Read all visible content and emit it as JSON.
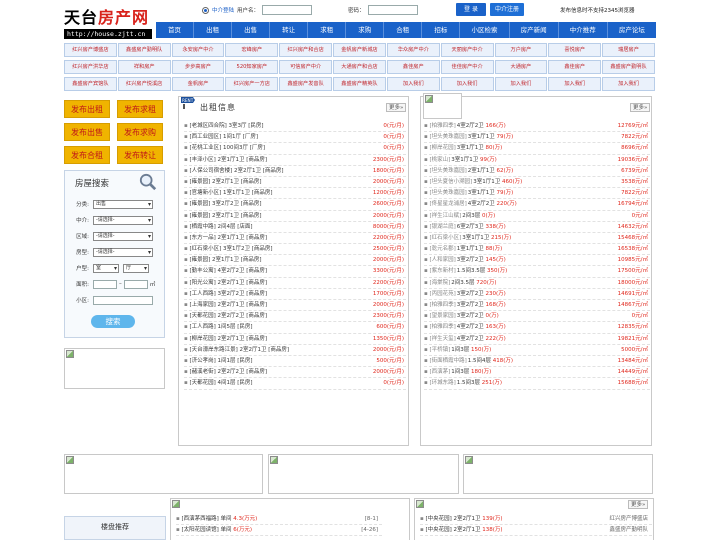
{
  "header": {
    "logo_text_a": "天台",
    "logo_text_b": "房产网",
    "logo_url": "http://house.zjtt.cn",
    "radio_label": "中介登陆",
    "username_label": "用户名：",
    "password_label": "密码：",
    "login_btn": "登 录",
    "register_btn": "中介注册",
    "notice": "发布信息时不支持2345浏览器"
  },
  "nav": [
    "首页",
    "出租",
    "出售",
    "转让",
    "求租",
    "求购",
    "合租",
    "招标",
    "小区检索",
    "房产新闻",
    "中介推荐",
    "房产论坛"
  ],
  "nav_row1": [
    "红兴房产博盛店",
    "鑫盛房产勤明队",
    "永安房产中介",
    "宏峰房产",
    "红兴房产和合店",
    "金帆房产新城店",
    "华众房产中介",
    "天丽房产中介",
    "万户房产",
    "喜悦房产",
    "瑞居房产"
  ],
  "nav_row2": [
    "红兴房产洪华店",
    "祥和房产",
    "步步高房产",
    "520知家房产",
    "可信房产中介",
    "大通房产和合店",
    "鑫佳房产",
    "佳佳房产中介",
    "大通房产",
    "鑫佳房产",
    "鑫盛房产勤明队"
  ],
  "nav_row3": [
    "鑫盛房产宾馆队",
    "红兴房产悦溪店",
    "金帆房产",
    "红兴房产一方店",
    "鑫盛房产发音队",
    "鑫盛房产精英队",
    "加入我们",
    "加入我们",
    "加入我们",
    "加入我们",
    "加入我们"
  ],
  "left": {
    "buttons": [
      "发布出租",
      "发布求租",
      "发布出售",
      "发布求购",
      "发布合租",
      "发布转让"
    ],
    "search_title": "房屋搜索",
    "f_type": "分类:",
    "f_type_val": "出售",
    "f_agent": "中介:",
    "f_agent_val": "-请选择-",
    "f_area": "区域:",
    "f_area_val": "-请选择-",
    "f_house": "房型:",
    "f_house_val": "-请选择-",
    "f_layout": "户型:",
    "f_room": "室",
    "f_hall": "厅",
    "f_size": "面积:",
    "f_size_unit": "㎡",
    "f_community": "小区:",
    "search_btn": "搜索",
    "recommend": "楼盘推荐"
  },
  "rent": {
    "badge": "RENT",
    "title": "出租信息",
    "more": "更多»",
    "items": [
      {
        "t": "[老城区四合院] 3室3厅 [民房]",
        "p": "0(元/月)"
      },
      {
        "t": "[西工业园区] 1间1厅 [厂房]",
        "p": "0(元/月)"
      },
      {
        "t": "[花桃工业区] 100间3厅 [厂房]",
        "p": "0(元/月)"
      },
      {
        "t": "[丰泽小区] 2室1厅1卫 [商品房]",
        "p": "2300(元/月)"
      },
      {
        "t": "[人保公司宿舍楼] 2室2厅1卫 [商品房]",
        "p": "1800(元/月)"
      },
      {
        "t": "[雍景园] 2室2厅1卫 [商品房]",
        "p": "2000(元/月)"
      },
      {
        "t": "[官塘新小区] 1室1厅1卫 [商品房]",
        "p": "1200(元/月)"
      },
      {
        "t": "[雍景园] 3室2厅2卫 [商品房]",
        "p": "2600(元/月)"
      },
      {
        "t": "[雍景园] 2室2厅1卫 [商品房]",
        "p": "2000(元/月)"
      },
      {
        "t": "[栖霞中路] 2间4层 [店面]",
        "p": "8000(元/月)"
      },
      {
        "t": "[东方一品] 2室1厅1卫 [商品房]",
        "p": "2200(元/月)"
      },
      {
        "t": "[红石梁小区] 3室1厅2卫 [商品房]",
        "p": "2500(元/月)"
      },
      {
        "t": "[雍景园] 2室1厅1卫 [商品房]",
        "p": "2000(元/月)"
      },
      {
        "t": "[勤丰公寓] 4室2厅2卫 [商品房]",
        "p": "3300(元/月)"
      },
      {
        "t": "[阳光公寓] 2室2厅1卫 [商品房]",
        "p": "2200(元/月)"
      },
      {
        "t": "[工人西路] 3室2厅2卫 [商品房]",
        "p": "1700(元/月)"
      },
      {
        "t": "[上海家园] 2室2厅1卫 [商品房]",
        "p": "2000(元/月)"
      },
      {
        "t": "[天都花园] 2室2厅2卫 [商品房]",
        "p": "2300(元/月)"
      },
      {
        "t": "[工人西路] 1间5层 [民房]",
        "p": "600(元/月)"
      },
      {
        "t": "[柳岸花园] 2室2厅1卫 [商品房]",
        "p": "1350(元/月)"
      },
      {
        "t": "[天台濠岸东路江景] 2室2厅1卫 [商品房]",
        "p": "2000(元/月)"
      },
      {
        "t": "[济公孝岗] 1间1层 [民房]",
        "p": "500(元/月)"
      },
      {
        "t": "[赭溪老街] 2室2厅2卫 [商品房]",
        "p": "2000(元/月)"
      },
      {
        "t": "[天都花园] 4间1层 [民房]",
        "p": "0(元/月)"
      }
    ]
  },
  "sale": {
    "more": "更多»",
    "items": [
      {
        "b": "[柏雅四季]",
        "t": "4室2厅2卫",
        "s": "166(万)",
        "p": "12769元/㎡"
      },
      {
        "b": "[坦头美珠嘉园]",
        "t": "3室1厅1卫",
        "s": "79(万)",
        "p": "7822元/㎡"
      },
      {
        "b": "[柳岸花园]",
        "t": "3室1厅1卫",
        "s": "80(万)",
        "p": "8696元/㎡"
      },
      {
        "b": "[桃家山]",
        "t": "3室1厅1卫",
        "s": "99(万)",
        "p": "19036元/㎡"
      },
      {
        "b": "[坦头美珠嘉园]",
        "t": "2室1厅1卫",
        "s": "62(万)",
        "p": "6739元/㎡"
      },
      {
        "b": "[坦头夏信小溯园]",
        "t": "3室1厅1卫",
        "s": "460(万)",
        "p": "3538元/㎡"
      },
      {
        "b": "[坦头美珠嘉园]",
        "t": "3室1厅1卫",
        "s": "79(万)",
        "p": "7822元/㎡"
      },
      {
        "b": "[佟星星龙浦居]",
        "t": "4室2厅2卫",
        "s": "220(万)",
        "p": "16794元/㎡"
      },
      {
        "b": "[祥生江山赋]",
        "t": "2间3层",
        "s": "0(万)",
        "p": "0元/㎡"
      },
      {
        "b": "[银湖兰庭]",
        "t": "6室2厅3卫",
        "s": "338(万)",
        "p": "14632元/㎡"
      },
      {
        "b": "[红石梁小区]",
        "t": "3室1厅1卫",
        "s": "215(万)",
        "p": "15468元/㎡"
      },
      {
        "b": "[乾元名郡]",
        "t": "1室1厅1卫",
        "s": "88(万)",
        "p": "16538元/㎡"
      },
      {
        "b": "[人和家园]",
        "t": "3室2厅2卫",
        "s": "145(万)",
        "p": "10985元/㎡"
      },
      {
        "b": "[紫东新村]",
        "t": "1.5间3.5层",
        "s": "350(万)",
        "p": "17500元/㎡"
      },
      {
        "b": "[海棠院]",
        "t": "2间3.5层",
        "s": "720(万)",
        "p": "18000元/㎡"
      },
      {
        "b": "[丙园花苑]",
        "t": "3室2厅2卫",
        "s": "230(万)",
        "p": "14691元/㎡"
      },
      {
        "b": "[柏雅四季]",
        "t": "3室2厅2卫",
        "s": "168(万)",
        "p": "14867元/㎡"
      },
      {
        "b": "[望景家园]",
        "t": "3室2厅2卫",
        "s": "0(万)",
        "p": "0元/㎡"
      },
      {
        "b": "[柏雅四季]",
        "t": "4室2厅2卫",
        "s": "163(万)",
        "p": "12835元/㎡"
      },
      {
        "b": "[祥生天玺]",
        "t": "4室2厅2卫",
        "s": "222(万)",
        "p": "19821元/㎡"
      },
      {
        "b": "[平桥镇]",
        "t": "1间3层",
        "s": "150(万)",
        "p": "5000元/㎡"
      },
      {
        "b": "[街面栖霞中路]",
        "t": "1.5间4层",
        "s": "418(万)",
        "p": "13484元/㎡"
      },
      {
        "b": "[西演茅]",
        "t": "1间3层",
        "s": "180(万)",
        "p": "14449元/㎡"
      },
      {
        "b": "[环城东路]",
        "t": "1.5间3层",
        "s": "251(万)",
        "p": "15688元/㎡"
      }
    ]
  },
  "bottom_left": [
    {
      "t": "[西演茅西福路] 单间",
      "s": "4.3(万元)",
      "r": "[8-1]"
    },
    {
      "t": "[太阳花园读馆] 单间",
      "s": "6(万元)",
      "r": "[4-26]"
    }
  ],
  "bottom_right": [
    {
      "t": "[中央花园] 2室2厅1卫",
      "s": "139(万)",
      "r": "红兴房产博盛店"
    },
    {
      "t": "[中央花园] 2室2厅1卫",
      "s": "138(万)",
      "r": "鑫盛房产勤明队"
    }
  ],
  "bottom_more": "更多»"
}
